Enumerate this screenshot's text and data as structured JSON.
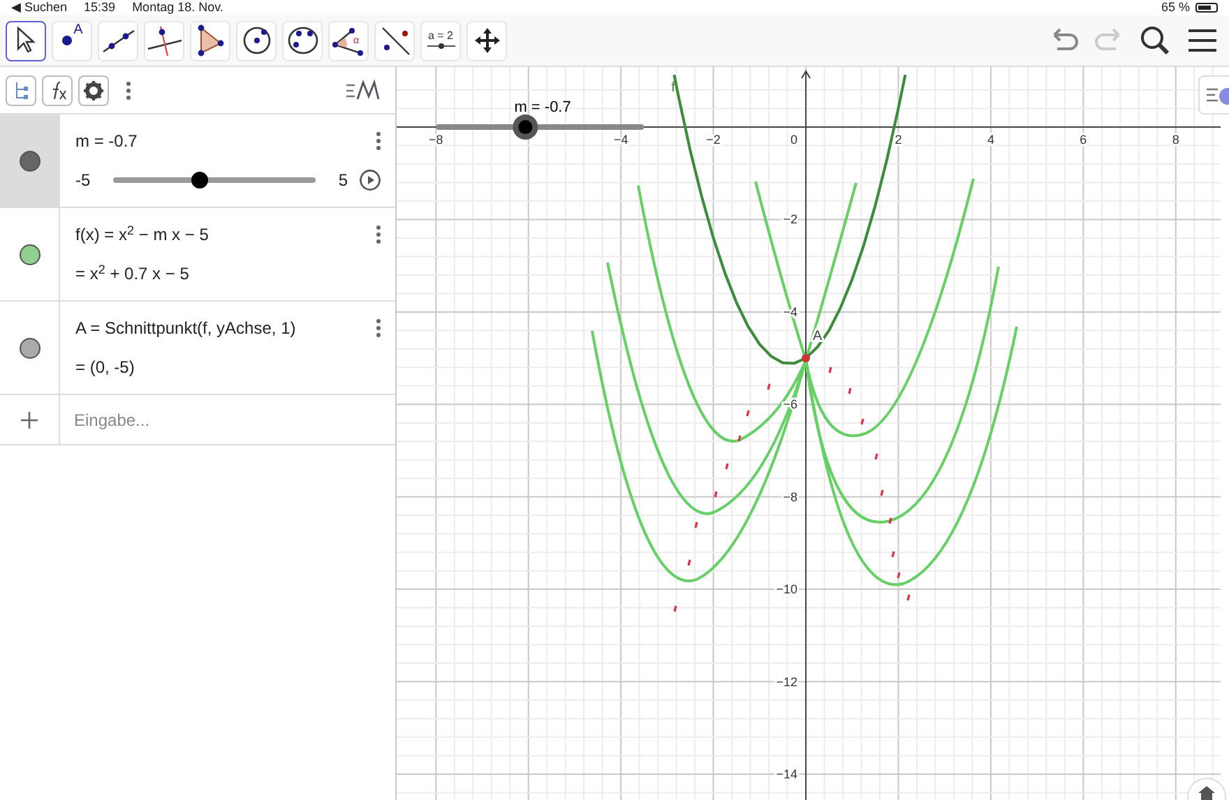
{
  "status_bar": {
    "back": "◀ Suchen",
    "time": "15:39",
    "date": "Montag 18. Nov.",
    "battery": "65 %"
  },
  "toolbar": {
    "tools": [
      {
        "kind": "move",
        "selected": true
      },
      {
        "kind": "point",
        "label": "A",
        "selected": false
      },
      {
        "kind": "line",
        "selected": false
      },
      {
        "kind": "perpendicular",
        "selected": false
      },
      {
        "kind": "polygon",
        "selected": false
      },
      {
        "kind": "circle",
        "selected": false
      },
      {
        "kind": "conic",
        "selected": false
      },
      {
        "kind": "angle",
        "label": "α",
        "selected": false
      },
      {
        "kind": "reflect",
        "selected": false
      },
      {
        "kind": "slider",
        "label": "a = 2",
        "selected": false
      },
      {
        "kind": "move_view",
        "selected": false
      }
    ],
    "undo_enabled": true,
    "redo_enabled": false
  },
  "algebra": {
    "items": [
      {
        "kind": "slider",
        "color": "#666666",
        "selected": true,
        "definition": "m = -0.7",
        "min": "-5",
        "max": "5",
        "level": 0.43
      },
      {
        "kind": "function",
        "color": "#90d090",
        "selected": false,
        "definition": "f(x) = x$^{2}$ − m x − 5",
        "value": "= x$^{2}$ + 0.7 x − 5"
      },
      {
        "kind": "point",
        "color": "#aaaaaa",
        "selected": false,
        "definition": "A = Schnittpunkt(f, yAchse, 1)",
        "value": "= (0, -5)"
      }
    ],
    "input_placeholder": "Eingabe..."
  },
  "graphics": {
    "slider_label": "m = -0.7",
    "slider": {
      "level": 0.43
    },
    "point_label": "A",
    "origin_label": "0",
    "chart_data": {
      "type": "line",
      "x": [
        -2.85,
        -2.75,
        -2.5,
        -2.25,
        -2,
        -1.75,
        -1.5,
        -1.25,
        -1,
        -0.75,
        -0.5,
        -0.25,
        0,
        0.25,
        0.5,
        0.75,
        1,
        1.25,
        1.5,
        1.75,
        2,
        2.15
      ],
      "series": [
        {
          "name": "f",
          "color": "#3c8c3c",
          "values": [
            1.13,
            0.64,
            -0.5,
            -1.51,
            -2.4,
            -3.16,
            -3.8,
            -4.31,
            -4.7,
            -4.96,
            -5.1,
            -5.11,
            -5,
            -4.76,
            -4.4,
            -3.91,
            -3.3,
            -2.56,
            -1.7,
            -0.71,
            0.4,
            1.13
          ]
        }
      ],
      "grid": true,
      "xlim": [
        -8.85,
        8.97
      ],
      "ylim": [
        -14.56,
        1.3
      ],
      "xticks": [
        {
          "value": -8,
          "label": "−8"
        },
        {
          "value": -4,
          "label": "−4"
        },
        {
          "value": -2,
          "label": "−2"
        },
        {
          "value": 2,
          "label": "2"
        },
        {
          "value": 4,
          "label": "4"
        },
        {
          "value": 6,
          "label": "6"
        },
        {
          "value": 8,
          "label": "8"
        }
      ],
      "yticks": [
        {
          "value": -2,
          "label": "−2"
        },
        {
          "value": -4,
          "label": "−4"
        },
        {
          "value": -6,
          "label": "−6"
        },
        {
          "value": -8,
          "label": "−8"
        },
        {
          "value": -10,
          "label": "−10"
        },
        {
          "value": -12,
          "label": "−12"
        },
        {
          "value": -14,
          "label": "−14"
        }
      ]
    }
  }
}
